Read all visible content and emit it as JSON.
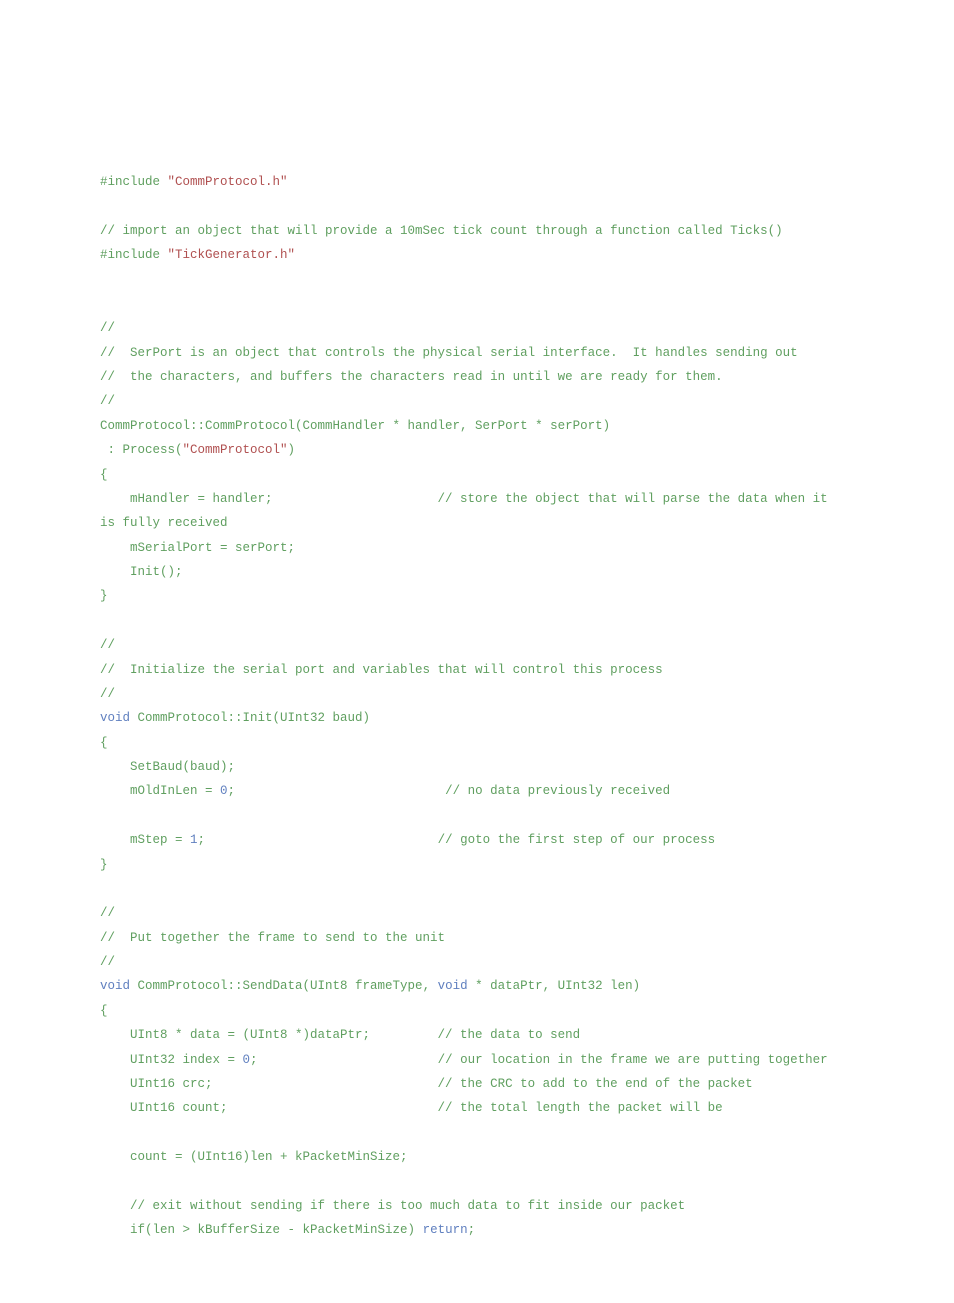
{
  "inc1a": "#include ",
  "inc1b": "\"CommProtocol.h\"",
  "blank": " ",
  "c1": "// import an object that will provide a 10mSec tick count through a function called Ticks()",
  "inc2a": "#include ",
  "inc2b": "\"TickGenerator.h\"",
  "c2a": "//",
  "c2b": "//  SerPort is an object that controls the physical serial interface.  It handles sending out",
  "c2c": "//  the characters, and buffers the characters read in until we are ready for them.",
  "c2d": "//",
  "ctor1": "CommProtocol::CommProtocol(CommHandler * handler, SerPort * serPort)",
  "ctor2a": " : Process(",
  "ctor2b": "\"CommProtocol\"",
  "ctor2c": ")",
  "ob": "{",
  "h1a": "    mHandler = handler;                      // store the object that will parse the data when it ",
  "h1b": "is fully received",
  "sp": "    mSerialPort = serPort;",
  "ini": "    Init();",
  "cb": "}",
  "c3a": "//",
  "c3b": "//  Initialize the serial port and variables that will control this process",
  "c3c": "//",
  "i1a": "void",
  "i1b": " CommProtocol::Init(UInt32 baud)",
  "sb": "    SetBaud(baud);",
  "oi1": "    mOldInLen = ",
  "oi2": "0",
  "oi3": ";                            // no data previously received",
  "ms1": "    mStep = ",
  "ms2": "1",
  "ms3": ";                               // goto the first step of our process",
  "c4a": "//",
  "c4b": "//  Put together the frame to send to the unit",
  "c4c": "//",
  "sd1a": "void",
  "sd1b": " CommProtocol::SendData(UInt8 frameType, ",
  "sd1c": "void",
  "sd1d": " * dataPtr, UInt32 len)",
  "d1": "    UInt8 * data = (UInt8 *)dataPtr;         // the data to send",
  "ix1": "    UInt32 index = ",
  "ix2": "0",
  "ix3": ";                        // our location in the frame we are putting together",
  "crc": "    UInt16 crc;                              // the CRC to add to the end of the packet",
  "cnt": "    UInt16 count;                            // the total length the packet will be",
  "cnt2": "    count = (UInt16)len + kPacketMinSize;",
  "ex1": "    // exit without sending if there is too much data to fit inside our packet",
  "ret1": "    if(len > kBufferSize - kPacketMinSize) ",
  "ret2": "return",
  "ret3": ";"
}
